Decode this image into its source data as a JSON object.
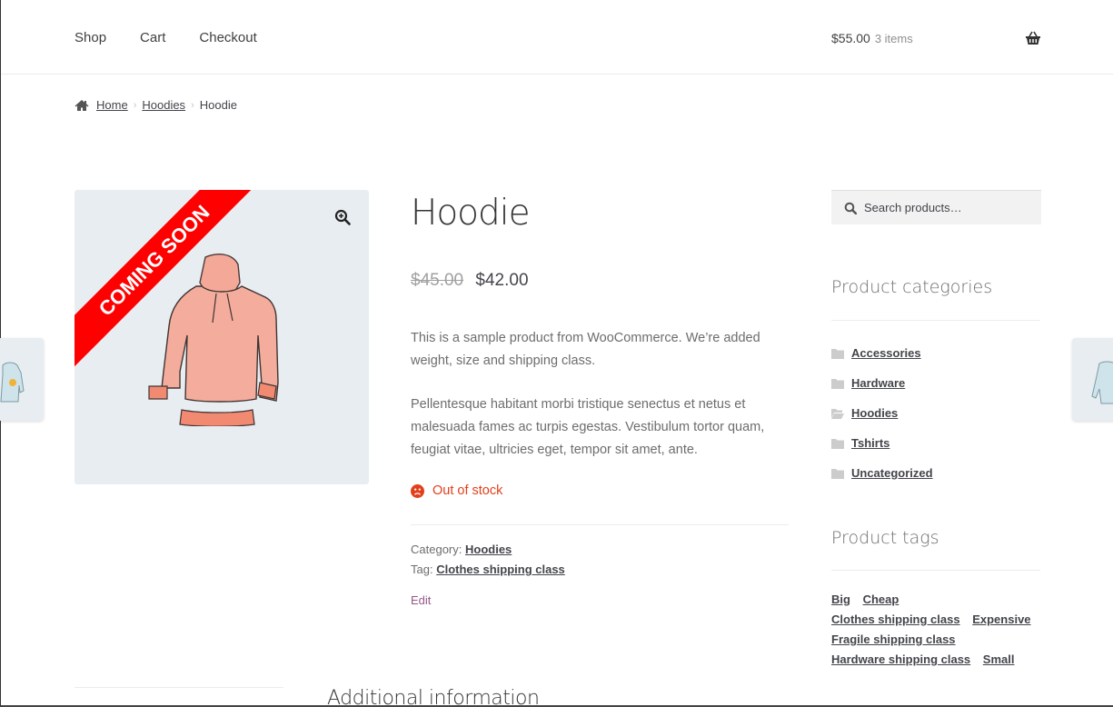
{
  "header": {
    "nav": [
      {
        "label": "Shop"
      },
      {
        "label": "Cart"
      },
      {
        "label": "Checkout"
      }
    ],
    "cart": {
      "total": "$55.00",
      "count": "3 items",
      "icon": "basket-icon"
    }
  },
  "breadcrumb": {
    "icon": "home-icon",
    "items": [
      {
        "label": "Home",
        "link": true
      },
      {
        "label": "Hoodies",
        "link": true
      },
      {
        "label": "Hoodie",
        "link": false
      }
    ],
    "separator": "›"
  },
  "product": {
    "image": {
      "ribbon": "COMING SOON",
      "ribbon_color": "#ff0000",
      "zoom_icon": "zoom-in-icon",
      "background": "#e8edf1"
    },
    "title": "Hoodie",
    "price_regular": "$45.00",
    "price_sale": "$42.00",
    "description": [
      "This is a sample product from WooCommerce. We’re added weight, size and shipping class.",
      "Pellentesque habitant morbi tristique senectus et netus et malesuada fames ac turpis egestas. Vestibulum tortor quam, feugiat vitae, ultricies eget, tempor sit amet, ante."
    ],
    "stock": {
      "label": "Out of stock",
      "icon": "frown-icon",
      "color": "#e2401c"
    },
    "meta": {
      "category_label": "Category:",
      "category": "Hoodies",
      "tag_label": "Tag:",
      "tag": "Clothes shipping class"
    },
    "edit_label": "Edit"
  },
  "sidebar": {
    "search": {
      "placeholder": "Search products…",
      "value": ""
    },
    "categories_title": "Product categories",
    "categories": [
      {
        "label": "Accessories",
        "icon": "folder-icon"
      },
      {
        "label": "Hardware",
        "icon": "folder-icon"
      },
      {
        "label": "Hoodies",
        "icon": "folder-open-icon"
      },
      {
        "label": "Tshirts",
        "icon": "folder-icon"
      },
      {
        "label": "Uncategorized",
        "icon": "folder-icon"
      }
    ],
    "tags_title": "Product tags",
    "tags": [
      {
        "label": "Big"
      },
      {
        "label": "Cheap"
      },
      {
        "label": "Clothes shipping class"
      },
      {
        "label": "Expensive"
      },
      {
        "label": "Fragile shipping class"
      },
      {
        "label": "Hardware shipping class"
      },
      {
        "label": "Small"
      }
    ]
  },
  "tabs": {
    "heading": "Additional information"
  }
}
